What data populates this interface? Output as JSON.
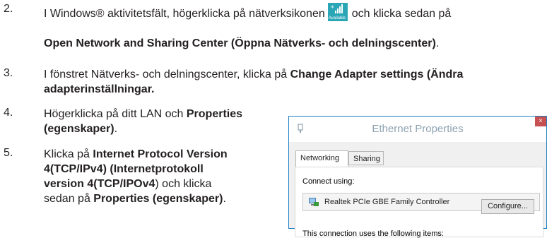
{
  "steps": [
    {
      "number": "2.",
      "line1_pre": "I Windows® aktivitetsfält, högerklicka på nätverksikonen",
      "line1_post": "och klicka sedan på",
      "line2_bold": "Open Network and Sharing Center (Öppna Nätverks- och delningscenter)",
      "line2_end": "."
    },
    {
      "number": "3.",
      "text_pre": "I fönstret Nätverks- och delningscenter, klicka på ",
      "bold1": "Change Adapter settings (Ändra",
      "bold2": "adapterinställningar."
    },
    {
      "number": "4.",
      "text_pre": "Högerklicka på ditt LAN och ",
      "bold1": "Properties",
      "bold2": "(egenskaper)",
      "text_end": "."
    },
    {
      "number": "5.",
      "text_pre": "Klicka på ",
      "bold1": "Internet Protocol Version",
      "bold2": "4(TCP/IPv4) (Internetprotokoll",
      "bold3": "version 4(TCP/IPOv4",
      "text_mid": ") och klicka",
      "text_line4_pre": "sedan på ",
      "bold4": "Properties (egenskaper)",
      "text_end": "."
    }
  ],
  "tray_icon": {
    "name": "network-signal-icon",
    "caption": "Available",
    "color": "#2ba6b6"
  },
  "dialog": {
    "title": "Ethernet Properties",
    "tabs": [
      "Networking",
      "Sharing"
    ],
    "connect_using_label": "Connect using:",
    "adapter_name": "Realtek PCIe GBE Family Controller",
    "configure_button": "Configure...",
    "items_label": "This connection uses the following items:",
    "close_glyph": "×"
  }
}
